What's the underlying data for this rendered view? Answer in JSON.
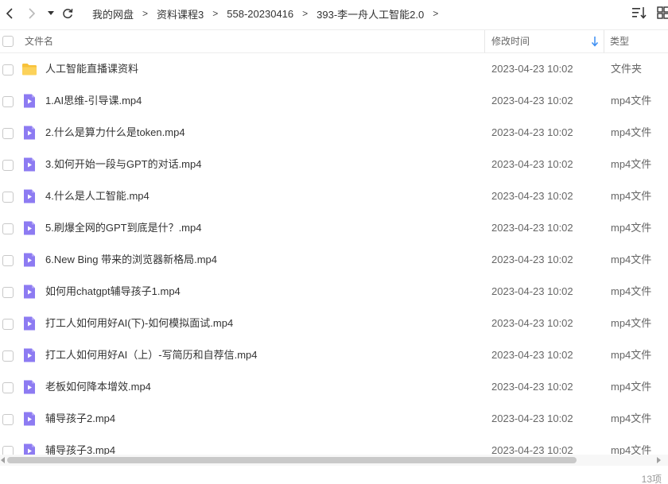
{
  "toolbar": {
    "back_icon": "chevron-left-icon",
    "forward_icon": "chevron-right-icon",
    "history_icon": "caret-down-icon",
    "refresh_icon": "refresh-icon",
    "sort_icon": "sort-icon",
    "view_icon": "grid-view-icon"
  },
  "breadcrumb": [
    "我的网盘",
    "资料课程3",
    "558-20230416",
    "393-李一舟人工智能2.0"
  ],
  "header": {
    "name": "文件名",
    "time": "修改时间",
    "type": "类型",
    "sort_direction": "down"
  },
  "files": [
    {
      "name": "人工智能直播课资料",
      "time": "2023-04-23 10:02",
      "type": "文件夹",
      "icon": "folder-icon"
    },
    {
      "name": "1.AI思维-引导课.mp4",
      "time": "2023-04-23 10:02",
      "type": "mp4文件",
      "icon": "video-file-icon"
    },
    {
      "name": "2.什么是算力什么是token.mp4",
      "time": "2023-04-23 10:02",
      "type": "mp4文件",
      "icon": "video-file-icon"
    },
    {
      "name": "3.如何开始一段与GPT的对话.mp4",
      "time": "2023-04-23 10:02",
      "type": "mp4文件",
      "icon": "video-file-icon"
    },
    {
      "name": "4.什么是人工智能.mp4",
      "time": "2023-04-23 10:02",
      "type": "mp4文件",
      "icon": "video-file-icon"
    },
    {
      "name": "5.刷爆全网的GPT到底是什？.mp4",
      "time": "2023-04-23 10:02",
      "type": "mp4文件",
      "icon": "video-file-icon"
    },
    {
      "name": "6.New Bing 带来的浏览器新格局.mp4",
      "time": "2023-04-23 10:02",
      "type": "mp4文件",
      "icon": "video-file-icon"
    },
    {
      "name": "如何用chatgpt辅导孩子1.mp4",
      "time": "2023-04-23 10:02",
      "type": "mp4文件",
      "icon": "video-file-icon"
    },
    {
      "name": "打工人如何用好AI(下)-如何模拟面试.mp4",
      "time": "2023-04-23 10:02",
      "type": "mp4文件",
      "icon": "video-file-icon"
    },
    {
      "name": "打工人如何用好AI（上）-写简历和自荐信.mp4",
      "time": "2023-04-23 10:02",
      "type": "mp4文件",
      "icon": "video-file-icon"
    },
    {
      "name": "老板如何降本增效.mp4",
      "time": "2023-04-23 10:02",
      "type": "mp4文件",
      "icon": "video-file-icon"
    },
    {
      "name": "辅导孩子2.mp4",
      "time": "2023-04-23 10:02",
      "type": "mp4文件",
      "icon": "video-file-icon"
    },
    {
      "name": "辅导孩子3.mp4",
      "time": "2023-04-23 10:02",
      "type": "mp4文件",
      "icon": "video-file-icon"
    }
  ],
  "status": {
    "count": "13项"
  },
  "colors": {
    "folder": "#f8c23a",
    "video": "#8d7bf2",
    "sort_arrow": "#3b8df2"
  }
}
